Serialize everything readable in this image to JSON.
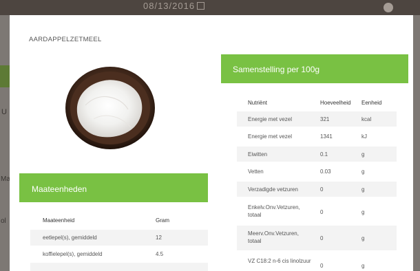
{
  "background": {
    "date_text": "08/13/2016",
    "left_fragments": [
      "U",
      "Ma",
      "ol"
    ]
  },
  "modal": {
    "title": "AARDAPPELZETMEEL",
    "image_alt": "bowl of potato starch powder",
    "portion_section": {
      "header": "Maateenheden",
      "columns": [
        "Maateenheid",
        "Gram"
      ],
      "rows": [
        {
          "unit": "eetlepel(s), gemiddeld",
          "gram": "12"
        },
        {
          "unit": "koffielepel(s), gemiddeld",
          "gram": "4.5"
        }
      ]
    },
    "composition_section": {
      "header": "Samenstelling per 100g",
      "columns": [
        "Nutriënt",
        "Hoeveelheid",
        "Eenheid"
      ],
      "rows": [
        {
          "nutrient": "Energie met vezel",
          "amount": "321",
          "unit": "kcal"
        },
        {
          "nutrient": "Energie met vezel",
          "amount": "1341",
          "unit": "kJ"
        },
        {
          "nutrient": "Eiwitten",
          "amount": "0.1",
          "unit": "g"
        },
        {
          "nutrient": "Vetten",
          "amount": "0.03",
          "unit": "g"
        },
        {
          "nutrient": "Verzadigde vetzuren",
          "amount": "0",
          "unit": "g"
        },
        {
          "nutrient": "Enkelv.Onv.Vetzuren, totaal",
          "amount": "0",
          "unit": "g"
        },
        {
          "nutrient": "Meerv.Onv.Vetzuren, totaal",
          "amount": "0",
          "unit": "g"
        },
        {
          "nutrient": "VZ C18:2 n-6 cis linolzuur",
          "amount": "0",
          "unit": "g"
        }
      ]
    }
  },
  "colors": {
    "accent_green": "#79c143",
    "overlay": "#6b6661"
  }
}
